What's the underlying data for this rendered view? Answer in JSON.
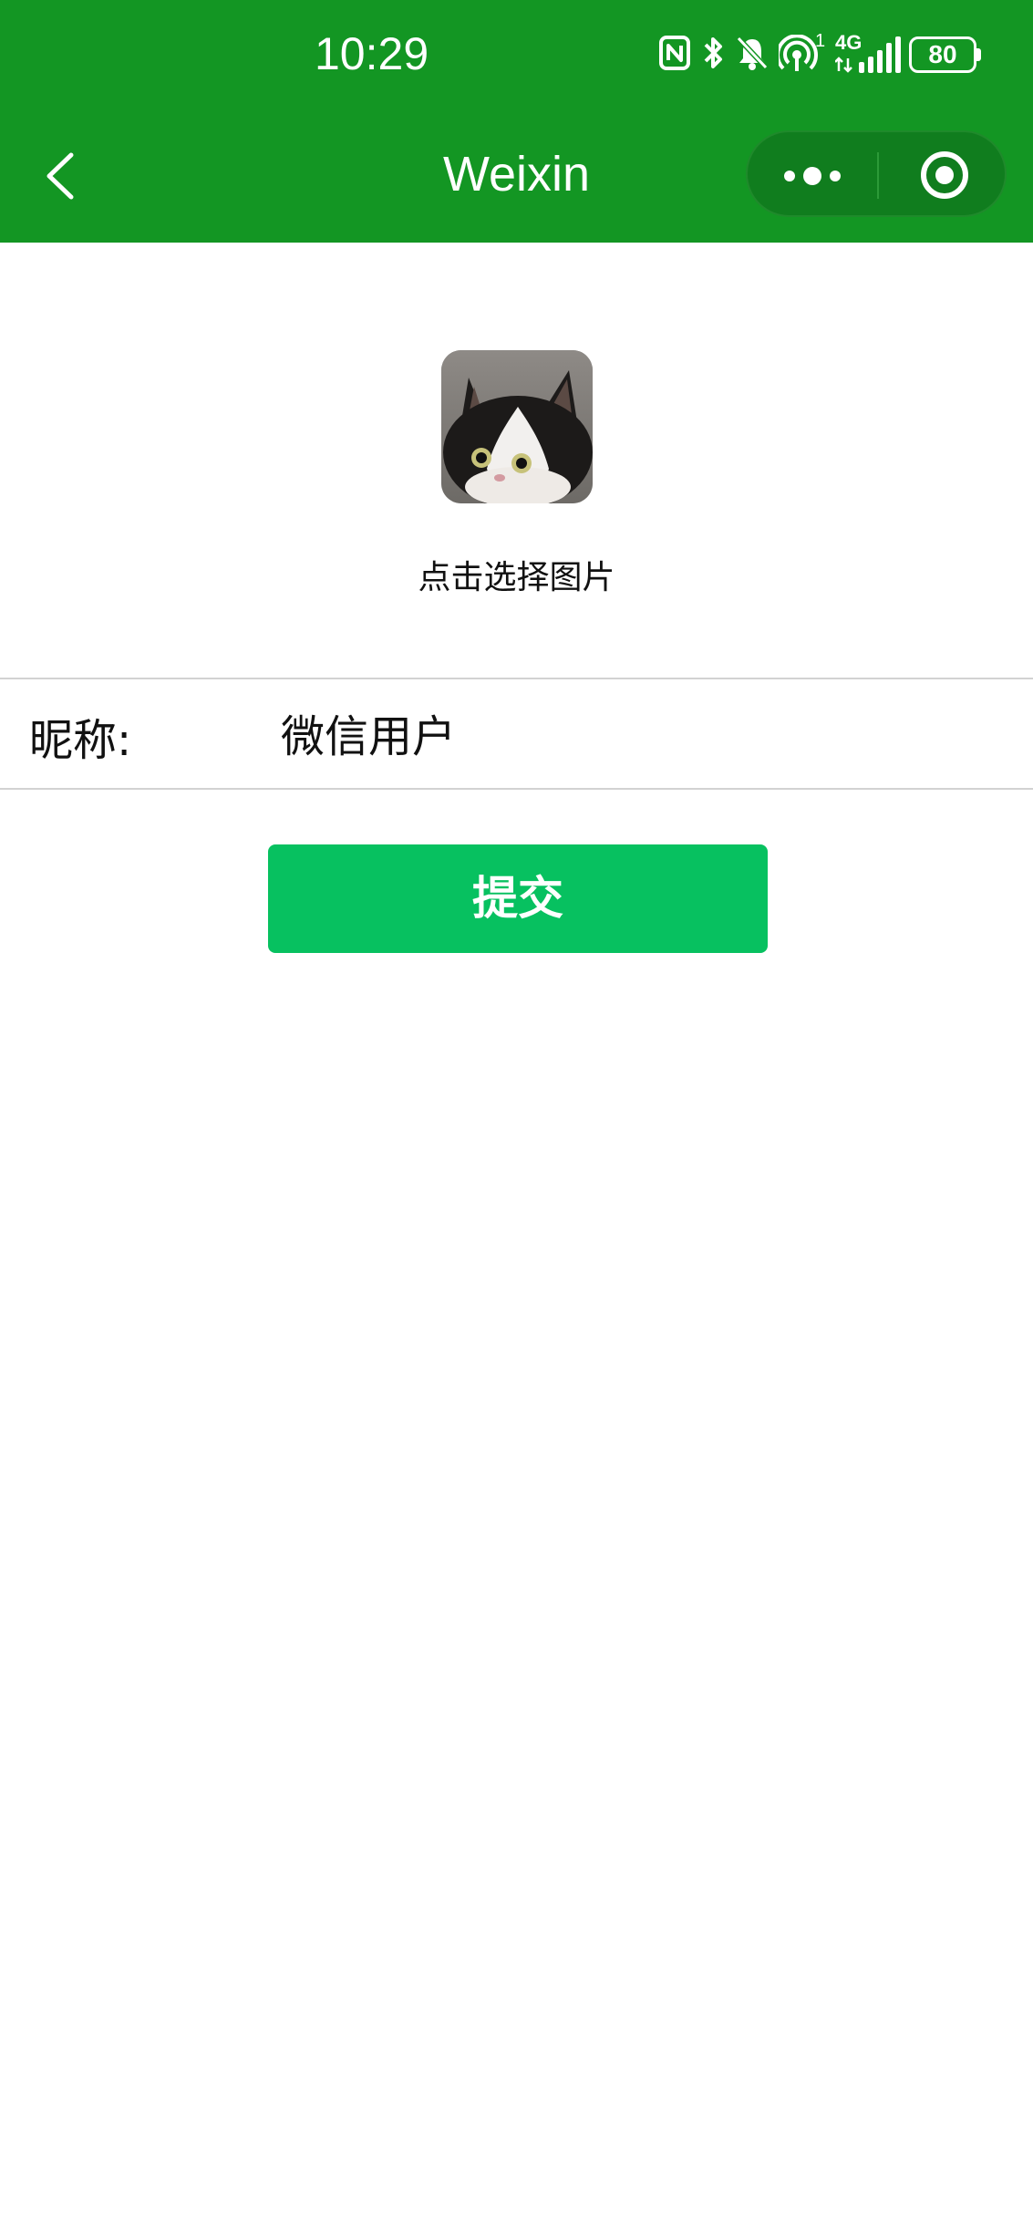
{
  "status_bar": {
    "time": "10:29",
    "network_label": "4G",
    "hotspot_count": "1",
    "battery_level": "80",
    "icons": [
      "nfc-icon",
      "bluetooth-icon",
      "bell-muted-icon",
      "hotspot-icon",
      "signal-icon",
      "battery-icon"
    ]
  },
  "nav_bar": {
    "title": "Weixin",
    "back_icon": "chevron-left-icon",
    "more_icon": "more-dots-icon",
    "close_icon": "target-close-icon"
  },
  "profile": {
    "avatar_hint": "点击选择图片",
    "nickname_label": "昵称:",
    "nickname_value": "微信用户",
    "submit_label": "提交"
  },
  "colors": {
    "header_bg": "#139623",
    "capsule_bg": "#107d1e",
    "primary_button": "#07c160",
    "divider": "#d2d2d2"
  }
}
